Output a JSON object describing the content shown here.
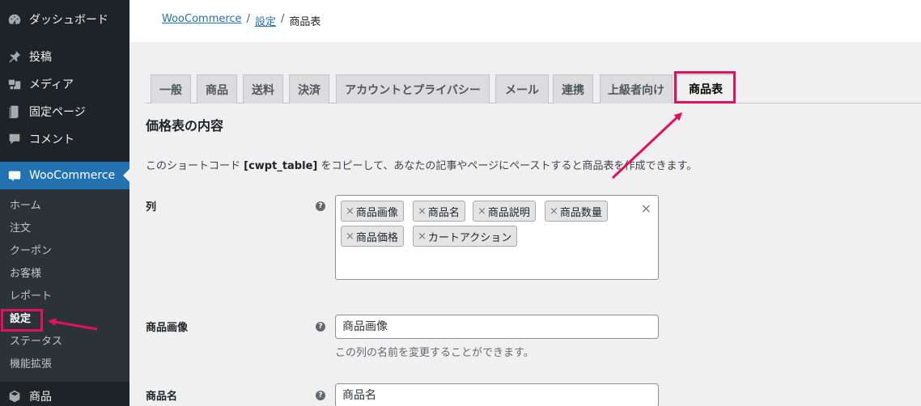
{
  "sidebar": {
    "items": [
      {
        "label": "ダッシュボード",
        "icon": "dashboard-icon"
      },
      {
        "label": "投稿",
        "icon": "pin-icon"
      },
      {
        "label": "メディア",
        "icon": "media-icon"
      },
      {
        "label": "固定ページ",
        "icon": "page-icon"
      },
      {
        "label": "コメント",
        "icon": "comment-icon"
      },
      {
        "label": "WooCommerce",
        "icon": "woo-icon"
      }
    ],
    "submenu": [
      "ホーム",
      "注文",
      "クーポン",
      "お客様",
      "レポート",
      "設定",
      "ステータス",
      "機能拡張"
    ],
    "bottom_item": {
      "label": "商品",
      "icon": "box-icon"
    }
  },
  "breadcrumb": {
    "root": "WooCommerce",
    "parent": "設定",
    "current": "商品表",
    "separator": "/"
  },
  "tabs": [
    "一般",
    "商品",
    "送料",
    "決済",
    "アカウントとプライバシー",
    "メール",
    "連携",
    "上級者向け",
    "商品表"
  ],
  "main": {
    "section_title": "価格表の内容",
    "intro_before": "このショートコード ",
    "intro_code": "[cwpt_table]",
    "intro_after": " をコピーして、あなたの記事やページにペーストすると商品表を作成できます。",
    "columns_label": "列",
    "columns_chips": [
      "商品画像",
      "商品名",
      "商品説明",
      "商品数量",
      "商品価格",
      "カートアクション"
    ],
    "chip_remove": "×",
    "clear_all": "×",
    "help_glyph": "?",
    "field_image_label": "商品画像",
    "field_image_value": "商品画像",
    "field_image_desc": "この列の名前を変更することができます。",
    "field_name_label": "商品名",
    "field_name_value": "商品名"
  },
  "colors": {
    "accent": "#2271b1",
    "highlight": "#e0115f",
    "sidebar_bg": "#1d2327"
  }
}
